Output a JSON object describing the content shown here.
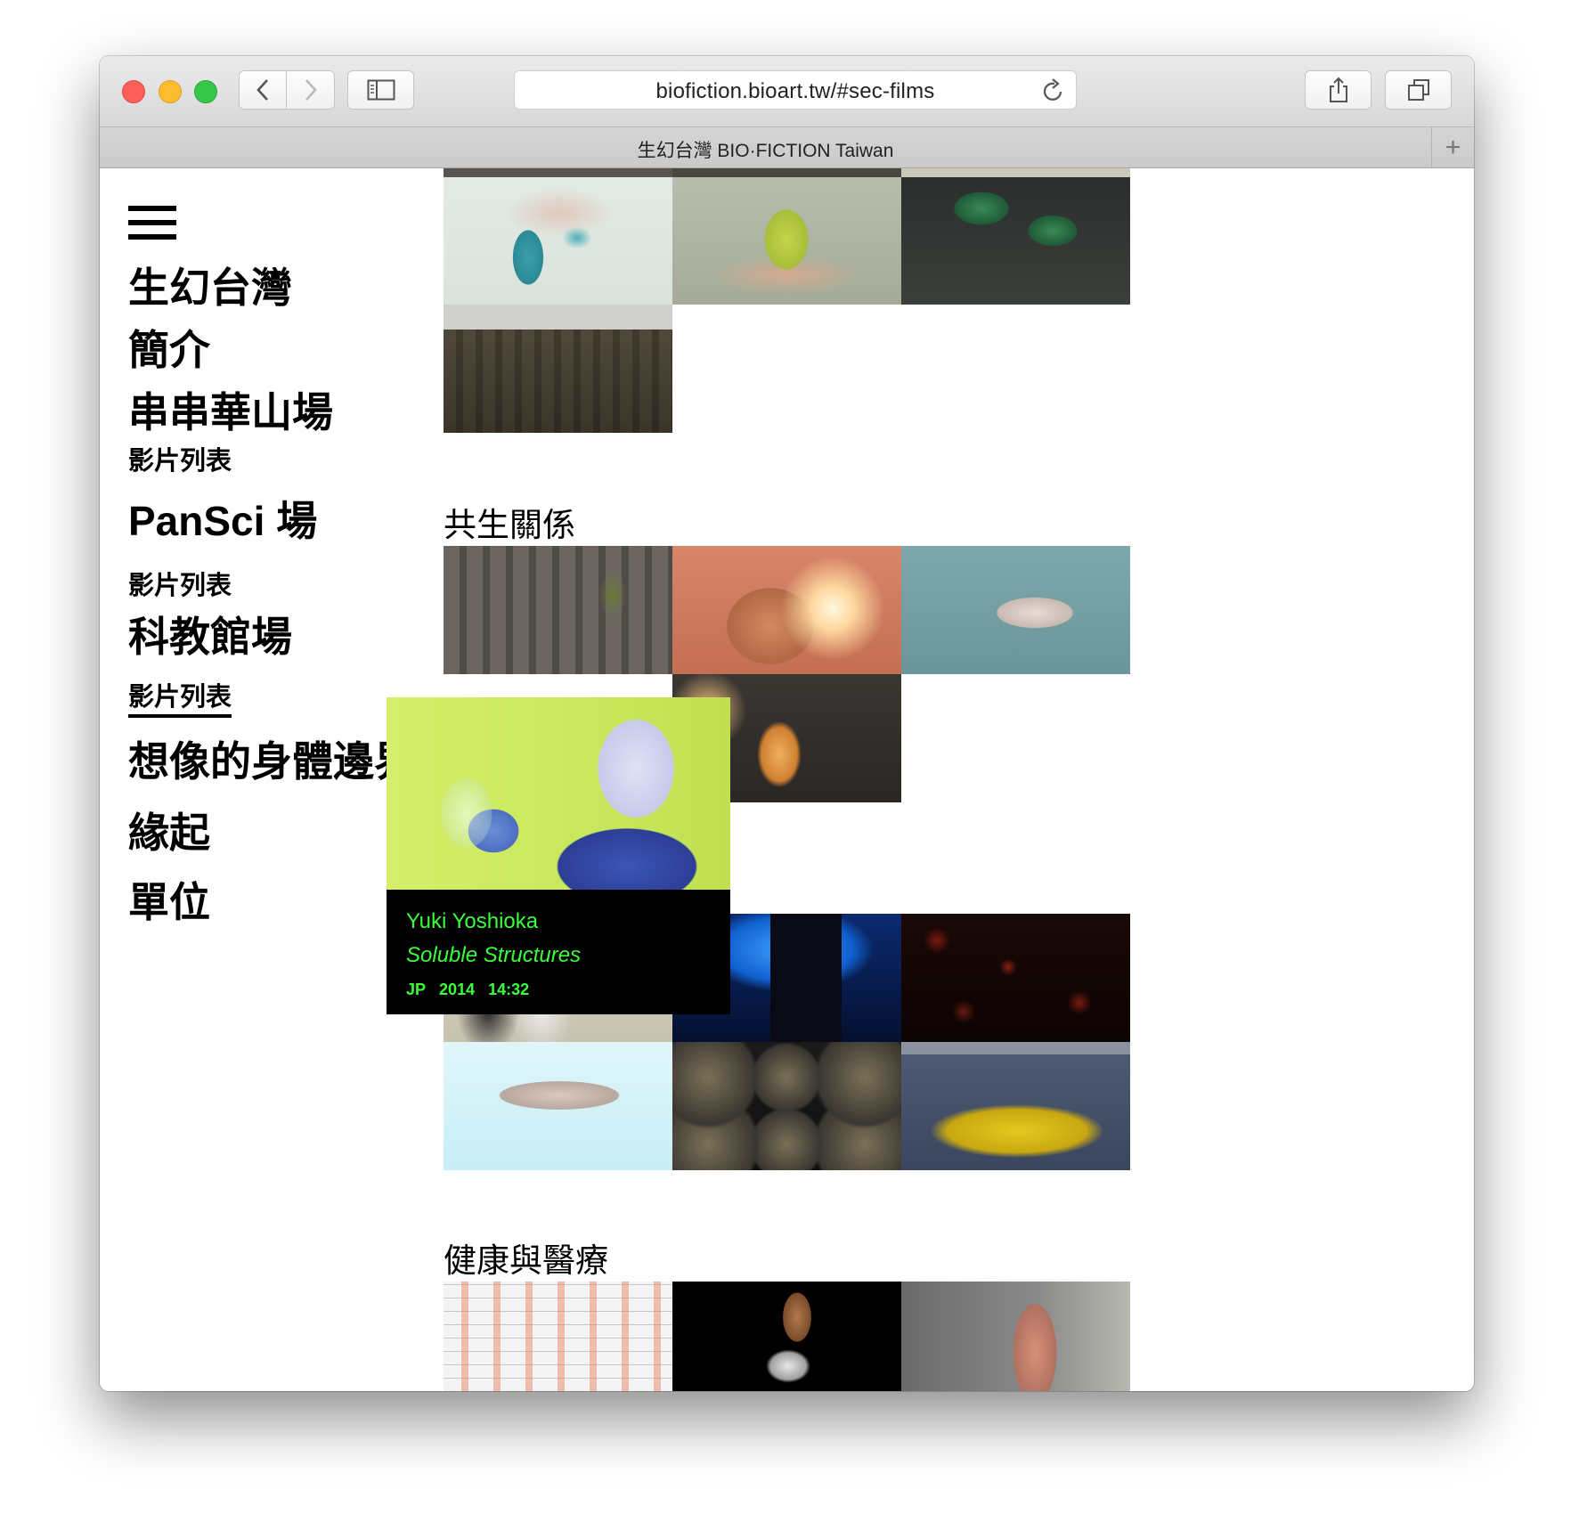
{
  "browser": {
    "url": "biofiction.bioart.tw/#sec-films",
    "tab_title": "生幻台灣 BIO·FICTION Taiwan",
    "new_tab": "+"
  },
  "nav": {
    "items": [
      {
        "label": "生幻台灣"
      },
      {
        "label": "簡介"
      },
      {
        "label": "串串華山場",
        "sub": "影片列表"
      },
      {
        "label": "PanSci 場",
        "sub": "影片列表"
      },
      {
        "label": "科教館場",
        "sub": "影片列表",
        "active": true
      },
      {
        "label": "想像的身體邊界"
      },
      {
        "label": "緣起"
      },
      {
        "label": "單位"
      }
    ]
  },
  "sections": [
    {
      "title": "共生關係"
    },
    {
      "title": "健康與醫療"
    }
  ],
  "tooltip": {
    "artist": "Yuki Yoshioka",
    "film_title": "Soluble Structures",
    "country": "JP",
    "year": "2014",
    "duration": "14:32",
    "text_color": "#3cff3c"
  }
}
